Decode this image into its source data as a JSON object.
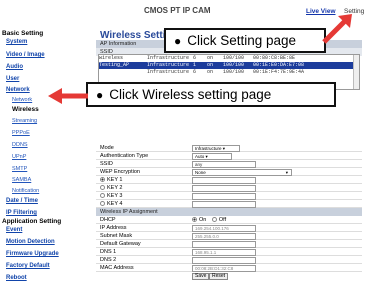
{
  "header": {
    "title": "CMOS PT IP CAM",
    "live_view": "Live View",
    "setting": "Setting"
  },
  "sidebar": {
    "basic_setting": "Basic Setting",
    "system": "System",
    "video_image": "Video / Image",
    "audio": "Audio",
    "user": "User",
    "network": "Network",
    "network_sub": "Network",
    "wireless": "Wireless",
    "streaming": "Streaming",
    "pppoe": "PPPoE",
    "ddns": "DDNS",
    "upnp": "UPnP",
    "smtp": "SMTP",
    "samba": "SAMBA",
    "notification": "Notification",
    "date_time": "Date / Time",
    "ip_filtering": "IP Filtering",
    "application_setting": "Application Setting",
    "event": "Event",
    "motion_detection": "Motion Detection",
    "firmware_upgrade": "Firmware Upgrade",
    "factory_default": "Factory Default",
    "reboot": "Reboot"
  },
  "main": {
    "title": "Wireless Setting",
    "ap_info": "AP Information",
    "ssid_header": "SSID",
    "ap_rows": [
      [
        "wireless",
        "Infrastructure",
        "6",
        "on",
        "100/100",
        "00:80:C8:BE:8E"
      ],
      [
        "Testing_AP",
        "Infrastructure",
        "1",
        "on",
        "100/100",
        "00:1E:E0:DA:E7:08"
      ],
      [
        "",
        "Infrastructure",
        "6",
        "on",
        "100/100",
        "00:1E:F4:7E:9E:4A"
      ],
      [
        "",
        "",
        "",
        "",
        "",
        ""
      ]
    ],
    "mode_label": "Mode",
    "mode_value": "Infrastructure",
    "auth_label": "Authentication Type",
    "auth_value": "Auto",
    "ssid_label": "SSID",
    "ssid_value": "any",
    "wep_label": "WEP Encryption",
    "wep_value": "None",
    "key1": "KEY 1",
    "key2": "KEY 2",
    "key3": "KEY 3",
    "key4": "KEY 4",
    "ip_assign": "Wireless IP Assignment",
    "dhcp_label": "DHCP",
    "dhcp_on": "On",
    "dhcp_off": "Off",
    "ip_label": "IP Address",
    "ip_value": "169.254.100.176",
    "mask_label": "Subnet Mask",
    "mask_value": "255.255.0.0",
    "gw_label": "Default Gateway",
    "gw_value": "",
    "dns1_label": "DNS 1",
    "dns1_value": "168.95.1.1",
    "dns2_label": "DNS 2",
    "dns2_value": "",
    "mac_label": "MAC Address",
    "mac_value": "00:08:2B:D1:32:C8",
    "save": "Save",
    "reset": "Reset"
  },
  "callouts": {
    "setting": "Click Setting page",
    "wireless": "Click Wireless setting page"
  },
  "colors": {
    "link": "#1144aa",
    "title": "#2a4a9a",
    "section": "#c8d0dc",
    "selected": "#1c3c9c",
    "arrow": "#e53935"
  }
}
